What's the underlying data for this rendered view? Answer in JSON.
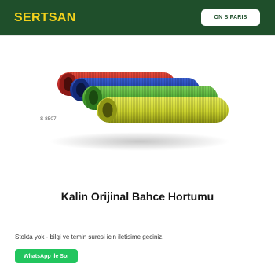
{
  "header": {
    "brand": "SERTSAN",
    "order_button": "ON SIPARIS"
  },
  "product": {
    "code": "S 8507",
    "title": "Kalin Orijinal Bahce Hortumu",
    "stock_info": "Stokta yok - bilgi ve temin suresi icin iletisime geciniz.",
    "whatsapp_button": "WhatsApp ile Sor",
    "hose_colors": [
      "#c62828",
      "#1e3fa8",
      "#4aa832",
      "#c8cf2c"
    ]
  },
  "colors": {
    "header_bg": "#1f4f2b",
    "brand": "#f3d21c",
    "whatsapp": "#22c55e"
  }
}
